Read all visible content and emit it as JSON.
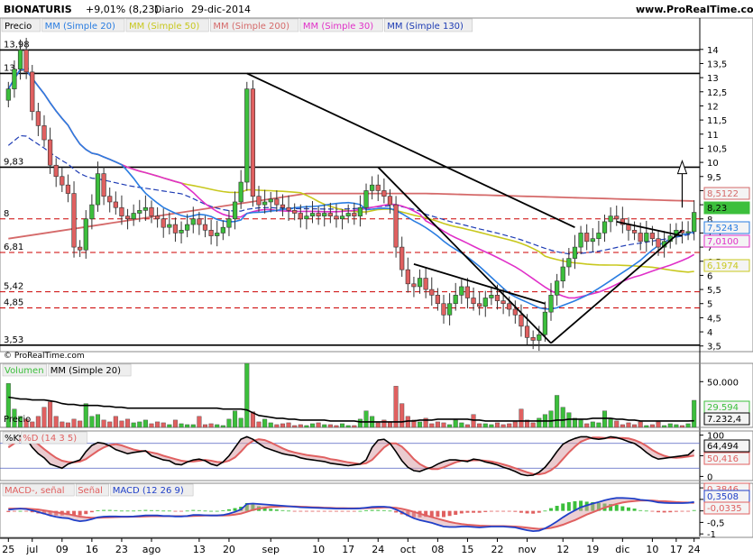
{
  "header": {
    "symbol": "BIONATURIS",
    "change": "+9,01% (8,23)",
    "period": "Diario",
    "date": "29-dic-2014",
    "site": "www.ProRealTime.com",
    "copyright": "© ProRealTime.com"
  },
  "colors": {
    "up": "#3cbf3c",
    "down": "#e06060",
    "ma20": "#2a7de1",
    "ma50": "#c8c81e",
    "ma200": "#d56a6a",
    "ma30": "#e030c8",
    "ma130": "#1e3cb4",
    "volume_ma": "#000000",
    "stoch_k": "#000000",
    "stoch_d": "#e06060",
    "macd": "#2040c8",
    "signal": "#e06060",
    "hist": "#3cbf3c"
  },
  "price_panel": {
    "legend": [
      "Precio",
      "MM (Simple 20)",
      "MM (Simple 50)",
      "MM (Simple 200)",
      "MM (Simple 30)",
      "MM (Simple 130)"
    ],
    "level_labels": [
      "13,98",
      "13,15",
      "9,83",
      "8",
      "6,81",
      "5,42",
      "4,85",
      "3,53"
    ],
    "value_tags": [
      "8,5122",
      "8,23",
      "7,5243",
      "7,0100",
      "6,1974"
    ]
  },
  "volume_panel": {
    "legend": [
      "Volumen",
      "MM (Simple 20)"
    ],
    "label": "Precio",
    "tick_labels": [
      "50.000"
    ],
    "value_tags": [
      "29.594",
      "7.232,4"
    ]
  },
  "stoch_panel": {
    "legend": [
      "%K",
      "%D (14 3 5)"
    ],
    "tick_labels": [
      "100",
      "50",
      "0"
    ],
    "value_tags": [
      "64,494",
      "50,416"
    ]
  },
  "macd_panel": {
    "legend": [
      "MACD-, señal",
      "Señal",
      "MACD (12 26 9)"
    ],
    "tick_labels": [
      "1",
      "0,5",
      "0",
      "-0,5",
      "-1"
    ],
    "value_tags": [
      "0,3846",
      "0,3508",
      "-0,0335"
    ]
  },
  "x_axis": {
    "labels": [
      "25",
      "jul",
      "09",
      "16",
      "23",
      "ago",
      "13",
      "20",
      "sep",
      "10",
      "17",
      "24",
      "oct",
      "08",
      "15",
      "22",
      "nov",
      "12",
      "19",
      "dic",
      "10",
      "17",
      "24"
    ]
  },
  "chart_data": {
    "type": "candlestick",
    "title": "BIONATURIS Diario",
    "y_ticks": [
      3.5,
      4,
      4.5,
      5,
      5.5,
      6,
      6.5,
      7,
      7.5,
      8,
      8.5,
      9,
      9.5,
      10,
      10.5,
      11,
      11.5,
      12,
      12.5,
      13,
      13.5,
      14
    ],
    "ylim": [
      3.3,
      14.6
    ],
    "horizontal_levels_solid": [
      13.98,
      13.15,
      9.83,
      3.53
    ],
    "horizontal_levels_dashed": [
      8,
      6.81,
      5.42,
      4.85
    ],
    "series": [
      {
        "name": "MM (Simple 20)",
        "last": 7.5243
      },
      {
        "name": "MM (Simple 50)",
        "last": 6.1974
      },
      {
        "name": "MM (Simple 200)",
        "last": 8.5122
      },
      {
        "name": "MM (Simple 30)",
        "last": 7.01
      }
    ],
    "last_close": 8.23,
    "closes": [
      12.6,
      13.3,
      13.98,
      13.2,
      11.8,
      11.3,
      10.8,
      9.9,
      9.5,
      9.2,
      8.9,
      7.0,
      6.9,
      8.0,
      8.5,
      9.6,
      8.8,
      8.6,
      8.4,
      8.1,
      8.0,
      8.2,
      8.3,
      8.4,
      8.1,
      8.0,
      7.7,
      7.8,
      7.5,
      7.6,
      7.8,
      8.0,
      7.8,
      7.6,
      7.4,
      7.5,
      7.7,
      8.0,
      8.6,
      9.3,
      12.6,
      8.8,
      8.5,
      8.6,
      8.7,
      8.5,
      8.4,
      8.3,
      8.2,
      8.0,
      8.1,
      8.2,
      8.1,
      8.2,
      8.1,
      8.0,
      8.1,
      8.2,
      8.1,
      8.4,
      9.0,
      9.2,
      9.0,
      8.8,
      8.5,
      7.0,
      6.2,
      5.7,
      5.6,
      5.9,
      5.5,
      5.3,
      5.0,
      4.6,
      5.0,
      5.3,
      5.6,
      5.2,
      5.0,
      4.9,
      5.2,
      5.3,
      5.1,
      5.0,
      4.8,
      4.6,
      4.2,
      3.8,
      3.7,
      3.9,
      4.7,
      5.3,
      5.8,
      6.3,
      6.6,
      7.0,
      7.5,
      7.2,
      7.3,
      7.5,
      7.9,
      8.1,
      8.0,
      7.8,
      7.6,
      7.5,
      7.2,
      7.5,
      7.3,
      7.0,
      7.2,
      7.4,
      7.6,
      7.5,
      7.55,
      8.23
    ],
    "volume": {
      "ylim": [
        0,
        70000
      ],
      "ticks": [
        50000
      ],
      "ma_last": 7232.4,
      "last": 29594,
      "values": [
        48000,
        20000,
        12000,
        9000,
        6000,
        12000,
        22000,
        28000,
        12000,
        6000,
        5000,
        9000,
        7000,
        26000,
        12000,
        14000,
        8000,
        6000,
        12000,
        7000,
        9000,
        5000,
        6000,
        8000,
        4000,
        6000,
        5000,
        3000,
        8000,
        4000,
        3000,
        3000,
        12000,
        3000,
        4000,
        3000,
        2000,
        9000,
        18000,
        10000,
        70000,
        17000,
        6000,
        9000,
        5000,
        3000,
        4000,
        5000,
        2000,
        3000,
        2000,
        4000,
        5000,
        3000,
        3000,
        2000,
        4000,
        2000,
        2000,
        9000,
        18000,
        12000,
        5000,
        8000,
        6000,
        45000,
        26000,
        12000,
        8000,
        6000,
        10000,
        4000,
        6000,
        5000,
        3000,
        8000,
        5000,
        3000,
        14000,
        4000,
        4000,
        3000,
        5000,
        3000,
        4000,
        6000,
        20000,
        8000,
        5000,
        10000,
        14000,
        18000,
        35000,
        22000,
        16000,
        10000,
        8000,
        4000,
        6000,
        5000,
        18000,
        9000,
        7000,
        3000,
        5000,
        3000,
        6000,
        2000,
        3000,
        6000,
        2000,
        4000,
        3000,
        2000,
        4000,
        29594
      ],
      "ma": [
        33000,
        32000,
        31000,
        31000,
        30000,
        30000,
        30000,
        29000,
        28000,
        26000,
        25000,
        25000,
        24000,
        24000,
        24000,
        24000,
        23000,
        23000,
        22000,
        22000,
        21000,
        21000,
        21000,
        21000,
        21000,
        21000,
        21000,
        21000,
        21000,
        21000,
        21000,
        21000,
        21000,
        21000,
        21000,
        21000,
        20000,
        20000,
        20000,
        20000,
        19000,
        16000,
        13000,
        12000,
        11000,
        10000,
        10000,
        9000,
        9000,
        8000,
        8000,
        8000,
        8000,
        8000,
        7000,
        7000,
        7000,
        7000,
        7000,
        6000,
        6000,
        6000,
        6000,
        6000,
        6000,
        6000,
        6000,
        7000,
        7000,
        8000,
        8000,
        8000,
        9000,
        9000,
        9000,
        9000,
        9000,
        9000,
        8000,
        8000,
        7000,
        7000,
        7000,
        7000,
        7000,
        7000,
        7000,
        7000,
        7000,
        7000,
        7000,
        7000,
        8000,
        8000,
        9000,
        9000,
        9000,
        9000,
        10000,
        10000,
        10000,
        10000,
        9000,
        9000,
        8000,
        8000,
        7000,
        7000,
        7000,
        7000,
        7000,
        7000,
        7000,
        7000,
        7000,
        7232.4
      ]
    },
    "stochastic": {
      "ylim": [
        -10,
        110
      ],
      "ticks": [
        100,
        50,
        0
      ],
      "k_last": 64.494,
      "d_last": 50.416,
      "k": [
        85,
        95,
        98,
        92,
        70,
        55,
        45,
        30,
        25,
        20,
        30,
        35,
        40,
        60,
        75,
        82,
        80,
        74,
        65,
        60,
        55,
        58,
        60,
        62,
        50,
        45,
        40,
        38,
        30,
        28,
        35,
        40,
        42,
        38,
        30,
        26,
        35,
        50,
        70,
        90,
        96,
        90,
        80,
        70,
        65,
        60,
        55,
        52,
        50,
        45,
        42,
        40,
        38,
        36,
        32,
        30,
        28,
        26,
        28,
        30,
        40,
        70,
        88,
        90,
        80,
        60,
        38,
        22,
        14,
        12,
        18,
        22,
        30,
        36,
        40,
        40,
        38,
        36,
        42,
        40,
        35,
        32,
        28,
        22,
        18,
        12,
        5,
        2,
        3,
        10,
        22,
        40,
        60,
        78,
        86,
        92,
        96,
        96,
        92,
        90,
        92,
        96,
        94,
        90,
        84,
        80,
        70,
        58,
        48,
        42,
        44,
        46,
        48,
        50,
        52,
        64.494
      ],
      "d": [
        70,
        80,
        88,
        92,
        88,
        78,
        66,
        55,
        45,
        38,
        35,
        34,
        36,
        42,
        52,
        62,
        70,
        76,
        78,
        75,
        70,
        65,
        62,
        61,
        58,
        55,
        50,
        46,
        42,
        38,
        36,
        36,
        38,
        40,
        38,
        35,
        34,
        38,
        46,
        60,
        76,
        86,
        90,
        88,
        82,
        75,
        68,
        62,
        58,
        55,
        52,
        50,
        48,
        46,
        42,
        40,
        37,
        34,
        32,
        30,
        32,
        40,
        55,
        70,
        80,
        80,
        72,
        58,
        42,
        30,
        22,
        18,
        18,
        22,
        28,
        34,
        38,
        38,
        39,
        39,
        38,
        36,
        33,
        29,
        25,
        20,
        15,
        10,
        6,
        5,
        8,
        15,
        26,
        42,
        58,
        72,
        84,
        90,
        94,
        94,
        93,
        93,
        93,
        93,
        92,
        88,
        82,
        74,
        64,
        56,
        50,
        46,
        45,
        46,
        48,
        50.416
      ]
    },
    "macd": {
      "ylim": [
        -1.15,
        1.2
      ],
      "ticks": [
        1,
        0.5,
        0,
        -0.5,
        -1
      ],
      "macd_last": 0.3846,
      "signal_last": 0.3508,
      "hist_last": -0.0335,
      "macd": [
        0.05,
        0.08,
        0.1,
        0.08,
        0.02,
        -0.05,
        -0.12,
        -0.2,
        -0.26,
        -0.3,
        -0.32,
        -0.4,
        -0.45,
        -0.42,
        -0.36,
        -0.28,
        -0.25,
        -0.24,
        -0.24,
        -0.25,
        -0.25,
        -0.24,
        -0.22,
        -0.2,
        -0.2,
        -0.2,
        -0.22,
        -0.22,
        -0.24,
        -0.24,
        -0.22,
        -0.18,
        -0.18,
        -0.19,
        -0.2,
        -0.2,
        -0.18,
        -0.12,
        -0.04,
        0.06,
        0.3,
        0.32,
        0.3,
        0.28,
        0.26,
        0.24,
        0.22,
        0.2,
        0.18,
        0.16,
        0.15,
        0.14,
        0.13,
        0.12,
        0.11,
        0.1,
        0.1,
        0.1,
        0.1,
        0.11,
        0.14,
        0.17,
        0.18,
        0.18,
        0.16,
        0.06,
        -0.06,
        -0.2,
        -0.32,
        -0.4,
        -0.46,
        -0.52,
        -0.6,
        -0.68,
        -0.7,
        -0.7,
        -0.68,
        -0.68,
        -0.7,
        -0.72,
        -0.7,
        -0.68,
        -0.68,
        -0.68,
        -0.7,
        -0.72,
        -0.78,
        -0.84,
        -0.88,
        -0.86,
        -0.76,
        -0.62,
        -0.46,
        -0.28,
        -0.12,
        0.02,
        0.16,
        0.24,
        0.32,
        0.38,
        0.46,
        0.52,
        0.56,
        0.56,
        0.55,
        0.53,
        0.48,
        0.46,
        0.42,
        0.37,
        0.35,
        0.34,
        0.34,
        0.34,
        0.35,
        0.3846
      ],
      "signal": [
        0.1,
        0.1,
        0.1,
        0.1,
        0.08,
        0.06,
        0.02,
        -0.02,
        -0.06,
        -0.1,
        -0.14,
        -0.2,
        -0.25,
        -0.28,
        -0.3,
        -0.3,
        -0.29,
        -0.28,
        -0.27,
        -0.26,
        -0.26,
        -0.25,
        -0.25,
        -0.24,
        -0.23,
        -0.23,
        -0.23,
        -0.23,
        -0.23,
        -0.23,
        -0.23,
        -0.22,
        -0.21,
        -0.2,
        -0.2,
        -0.2,
        -0.2,
        -0.19,
        -0.16,
        -0.12,
        -0.04,
        0.04,
        0.1,
        0.14,
        0.17,
        0.18,
        0.19,
        0.19,
        0.19,
        0.18,
        0.17,
        0.16,
        0.15,
        0.14,
        0.13,
        0.12,
        0.12,
        0.11,
        0.11,
        0.11,
        0.12,
        0.13,
        0.14,
        0.15,
        0.15,
        0.13,
        0.09,
        0.03,
        -0.04,
        -0.12,
        -0.2,
        -0.27,
        -0.34,
        -0.41,
        -0.48,
        -0.53,
        -0.57,
        -0.6,
        -0.62,
        -0.64,
        -0.65,
        -0.66,
        -0.66,
        -0.66,
        -0.67,
        -0.68,
        -0.7,
        -0.73,
        -0.76,
        -0.78,
        -0.77,
        -0.74,
        -0.68,
        -0.6,
        -0.5,
        -0.4,
        -0.28,
        -0.16,
        -0.06,
        0.04,
        0.14,
        0.22,
        0.3,
        0.36,
        0.4,
        0.43,
        0.45,
        0.45,
        0.45,
        0.43,
        0.42,
        0.4,
        0.38,
        0.37,
        0.36,
        0.3508
      ]
    }
  }
}
